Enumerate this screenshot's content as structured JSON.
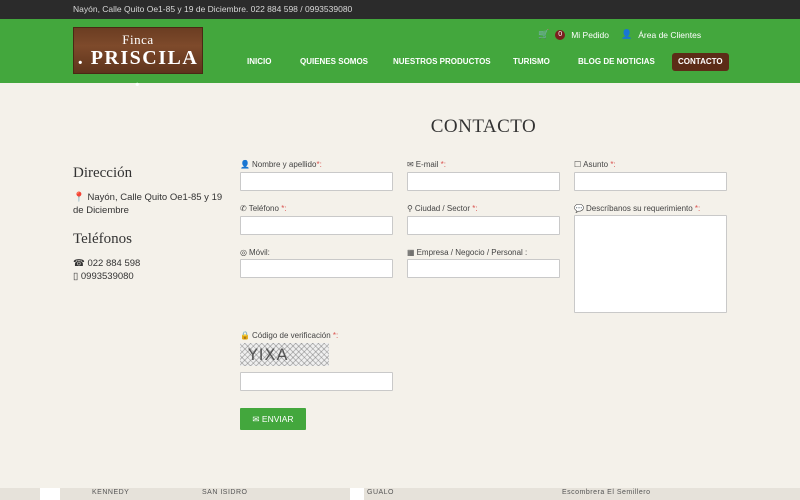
{
  "topbar": {
    "address_line": "Nayón, Calle Quito Oe1-85 y 19 de Diciembre. 022 884 598 / 0993539080"
  },
  "logo": {
    "line1": "Finca",
    "line2": ". PRISCILA ."
  },
  "utility": {
    "cart_count": "0",
    "cart_label": "Mi Pedido",
    "clients_label": "Área de Clientes",
    "cart_icon": "cart-icon",
    "user_icon": "user-icon"
  },
  "nav": {
    "items": [
      {
        "label": "INICIO"
      },
      {
        "label": "QUIENES SOMOS"
      },
      {
        "label": "NUESTROS PRODUCTOS"
      },
      {
        "label": "TURISMO"
      },
      {
        "label": "BLOG DE NOTICIAS"
      },
      {
        "label": "CONTACTO"
      }
    ],
    "active": "CONTACTO"
  },
  "page": {
    "title": "CONTACTO"
  },
  "sidebar": {
    "address_heading": "Dirección",
    "address_text": "Nayón, Calle Quito Oe1-85 y 19 de Diciembre",
    "phones_heading": "Teléfonos",
    "phone1": "022 884 598",
    "phone2": "0993539080"
  },
  "form": {
    "nombre_label": "Nombre y apellido",
    "email_label": "E-mail",
    "asunto_label": "Asunto",
    "telefono_label": "Teléfono",
    "ciudad_label": "Ciudad / Sector",
    "requerimiento_label": "Descríbanos su requerimiento",
    "movil_label": "Móvil:",
    "empresa_label": "Empresa / Negocio / Personal :",
    "codigo_label": "Código de verificación",
    "required_mark": "*:",
    "captcha_text": "YIXA",
    "submit_label": "ENVIAR"
  },
  "map": {
    "labels": [
      "KENNEDY",
      "SAN ISIDRO",
      "GUALO",
      "Escombrera El Semillero"
    ]
  },
  "colors": {
    "brand_green": "#43a73d",
    "active_nav": "#5c2c17",
    "topbar": "#2b2b2b",
    "required": "#d9534f"
  }
}
